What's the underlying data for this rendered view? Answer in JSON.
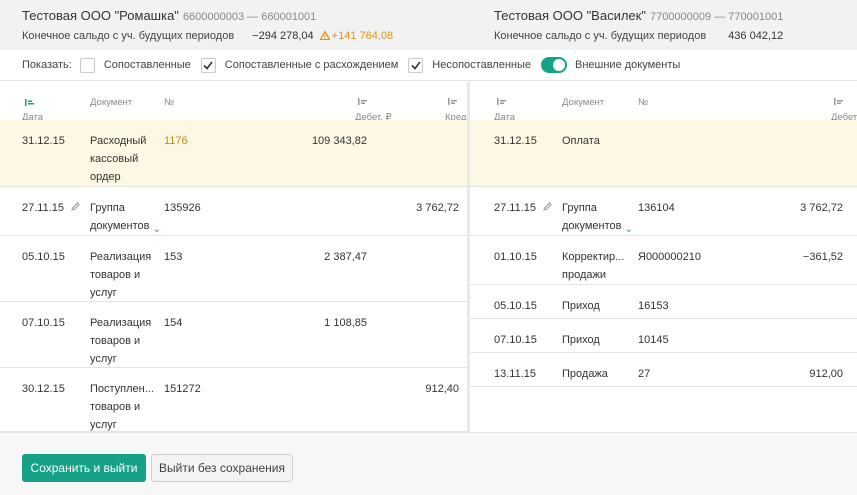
{
  "left_company": {
    "name": "Тестовая ООО \"Ромашка\"",
    "ids": "6600000003 — 660001001",
    "balance_label": "Конечное сальдо с уч. будущих периодов",
    "balance_value": "−294 278,04",
    "balance_diff": "+141 764,08"
  },
  "right_company": {
    "name": "Тестовая ООО \"Василек\"",
    "ids": "7700000009 — 770001001",
    "balance_label": "Конечное сальдо с уч. будущих периодов",
    "balance_value": "436 042,12"
  },
  "filters": {
    "show_label": "Показать:",
    "items": [
      {
        "label": "Сопоставленные",
        "checked": false
      },
      {
        "label": "Сопоставленные с расхождением",
        "checked": true
      },
      {
        "label": "Несопоставленные",
        "checked": true
      }
    ],
    "toggle_label": "Внешние документы",
    "toggle_on": true
  },
  "left_table": {
    "headers": {
      "date": "Дата",
      "doc": "Документ",
      "num": "№",
      "debit": "Дебет, ₽",
      "credit": "Кредит, ₽"
    },
    "rows": [
      {
        "date": "31.12.15",
        "doc": [
          "Расходный",
          "кассовый",
          "ордер"
        ],
        "num": "1176",
        "debit": "109 343,82",
        "credit": ""
      },
      {
        "date": "27.11.15",
        "doc": [
          "Группа",
          "документов"
        ],
        "num": "135926",
        "debit": "",
        "credit": "3 762,72"
      },
      {
        "date": "05.10.15",
        "doc": [
          "Реализация",
          "товаров и",
          "услуг"
        ],
        "num": "153",
        "debit": "2 387,47",
        "credit": ""
      },
      {
        "date": "07.10.15",
        "doc": [
          "Реализация",
          "товаров и",
          "услуг"
        ],
        "num": "154",
        "debit": "1 108,85",
        "credit": ""
      },
      {
        "date": "30.12.15",
        "doc": [
          "Поступлен...",
          "товаров и",
          "услуг"
        ],
        "num": "151272",
        "debit": "",
        "credit": "912,40"
      }
    ]
  },
  "right_table": {
    "headers": {
      "date": "Дата",
      "doc": "Документ",
      "num": "№",
      "debit": "Дебет, ₽"
    },
    "rows": [
      {
        "date": "31.12.15",
        "doc": [
          "Оплата"
        ],
        "num": "",
        "debit": ""
      },
      {
        "date": "27.11.15",
        "doc": [
          "Группа",
          "документов"
        ],
        "num": "136104",
        "debit": "3 762,72"
      },
      {
        "date": "01.10.15",
        "doc": [
          "Корректир...",
          "продажи"
        ],
        "num": "Я000000210",
        "debit": "−361,52"
      },
      {
        "date": "05.10.15",
        "doc": [
          "Приход"
        ],
        "num": "16153",
        "debit": ""
      },
      {
        "date": "07.10.15",
        "doc": [
          "Приход"
        ],
        "num": "10145",
        "debit": ""
      },
      {
        "date": "13.11.15",
        "doc": [
          "Продажа"
        ],
        "num": "27",
        "debit": "912,00"
      }
    ]
  },
  "buttons": {
    "save": "Сохранить и выйти",
    "cancel": "Выйти без сохранения"
  },
  "colors": {
    "accent": "#15a287",
    "warning": "#e2921d",
    "highlight": "#fdf8e3"
  }
}
